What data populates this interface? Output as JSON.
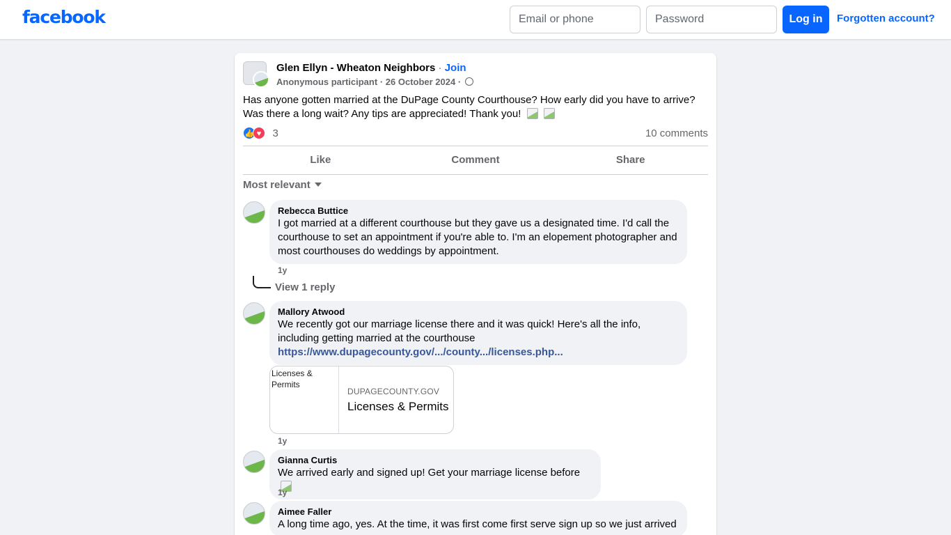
{
  "header": {
    "logo": "facebook",
    "email_placeholder": "Email or phone",
    "password_placeholder": "Password",
    "login_label": "Log in",
    "forgot_label": "Forgotten account?"
  },
  "post": {
    "group_name": "Glen Ellyn - Wheaton Neighbors",
    "separator": "·",
    "join_label": "Join",
    "author": "Anonymous participant",
    "date": "26 October 2024",
    "body": "Has anyone gotten married at the DuPage County Courthouse? How early did you have to arrive? Was there a long wait? Any tips are appreciated! Thank you!",
    "reaction_count": "3",
    "comment_count": "10 comments",
    "actions": {
      "like": "Like",
      "comment": "Comment",
      "share": "Share"
    },
    "sort_label": "Most relevant"
  },
  "comments": [
    {
      "name": "Rebecca Buttice",
      "text": "I got married at a different courthouse but they gave us a designated time. I'd call the courthouse to set an appointment if you're able to. I'm an elopement photographer and most courthouses do weddings by appointment.",
      "time": "1y",
      "reply_label": "View 1 reply"
    },
    {
      "name": "Mallory Atwood",
      "text": "We recently got our marriage license there and it was quick! Here's all the info, including getting married at the courthouse",
      "link": "https://www.dupagecounty.gov/.../county.../licenses.php...",
      "preview": {
        "alt": "Licenses & Permits",
        "domain": "DUPAGECOUNTY.GOV",
        "title": "Licenses & Permits"
      },
      "time": "1y"
    },
    {
      "name": "Gianna Curtis",
      "text": "We arrived early and signed up! Get your marriage license before",
      "time": "1y"
    },
    {
      "name": "Aimee Faller",
      "text": "A long time ago, yes. At the time, it was first come first serve sign up so we just arrived"
    }
  ]
}
